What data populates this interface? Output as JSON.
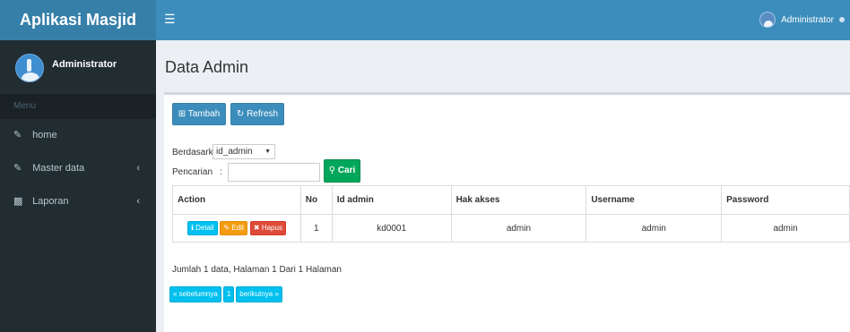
{
  "app": {
    "brand": "Aplikasi Masjid",
    "menu_toggle_icon": "hamburger-icon"
  },
  "topbar": {
    "user_name": "Administrator"
  },
  "sidebar": {
    "user_name": "Administrator",
    "menu_header": "Menu",
    "items": [
      {
        "label": "home",
        "icon": "edit-icon",
        "has_submenu": false
      },
      {
        "label": "Master data",
        "icon": "edit-icon",
        "has_submenu": true
      },
      {
        "label": "Laporan",
        "icon": "sitemap-icon",
        "has_submenu": true
      }
    ]
  },
  "page": {
    "title": "Data Admin"
  },
  "toolbar": {
    "add_label": "Tambah",
    "refresh_label": "Refresh"
  },
  "filter": {
    "label": "Berdasarkan:",
    "selected": "id_admin"
  },
  "search": {
    "label": "Pencarian",
    "colon": ":",
    "value": "",
    "button_label": "Cari"
  },
  "table": {
    "columns": [
      "Action",
      "No",
      "Id admin",
      "Hak akses",
      "Username",
      "Password"
    ],
    "rows": [
      {
        "actions": {
          "detail": "Detail",
          "edit": "Edit",
          "delete": "Hapus"
        },
        "no": "1",
        "id_admin": "kd0001",
        "hak_akses": "admin",
        "username": "admin",
        "password": "admin"
      }
    ]
  },
  "summary": "Jumlah 1 data, Halaman 1 Dari 1 Halaman",
  "pagination": {
    "prev": "« sebelumnya",
    "current": "1",
    "next": "berikutnya »"
  },
  "colors": {
    "header_blue": "#3c8dbc",
    "brand_blue": "#367fa9",
    "sidebar_dark": "#222d32",
    "success_green": "#00a65a",
    "info_cyan": "#00c0ef",
    "warning_orange": "#f39c12",
    "danger_red": "#dd4b39"
  }
}
